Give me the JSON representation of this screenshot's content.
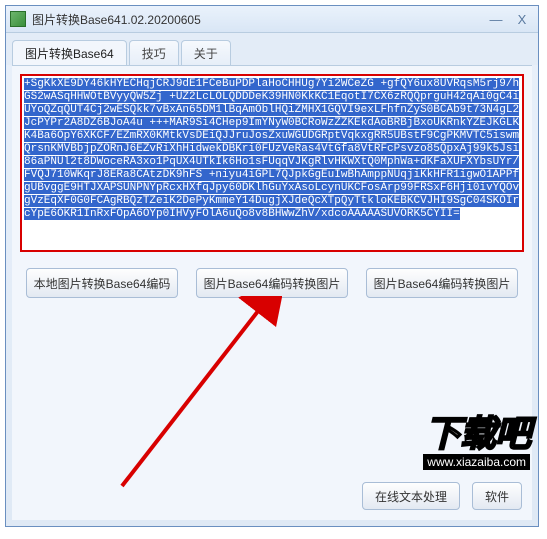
{
  "window": {
    "title": "图片转换Base641.02.20200605",
    "minimize": "—",
    "close": "X"
  },
  "tabs": [
    {
      "label": "图片转换Base64",
      "active": true
    },
    {
      "label": "技巧",
      "active": false
    },
    {
      "label": "关于",
      "active": false
    }
  ],
  "textbox": {
    "value": "+SgKkXE9DY46kHYECHqjCRJ9dE1FCeBuPDPlaHoCHHUg7Yi2WCeZG\n+gfQY6ux8UVRqsM5rj9/hGS2wASqHHWOtBVyyQW5Zj\n+UZ2LcLOLQDDDeK39HN0KkKC1EqotI7CX6zRQQprguH42qAi0gC4iUYoQZqQUT4Cj2wESQkk7vBxAn65DM1lBqAmOblHQiZMHX1GQVI9exLFhfnZyS0BCAb9t73N4gL2JcPYPr2A8DZ6BJoA4u\n+++MAR9Si4CHep9ImYNyW0BCRoWzZZKEkdAoBRBjBxoUKRnkYZEJKGLKK4Ba6OpY6XKCF/EZmRX0KMtkVsDEiQJJruJosZxuWGUDGRptVqkxgRR5UBstF9CgPKMVTC5iswmQrsnKMVBbjpZORnJ6EZvRiXhHidwekDBKri0FUzVeRas4VtGfa8VtRFcPsvzo85QpxAj99k5Jsi86aPNUl2t8DWoceRA3xo1PqUX4UTkIk6Ho1sFUqqVJKgRlvHKWXtQ0MphWa+dKFaXUFXYbsUYr/FVQJ710WKqrJ8ERa8CAtzDK9hFS\n+niyu4iGPL7QJpkGgEuIwBhAmppNUqjiKkHFR1igwO1APPfgUBvggE9HTJXAPSUNPNYpRcxHXfqJpy60DKlhGuYxAsoLcynUKCFosArp99FRSxF6Hji0ivYQOvgVzEqXF0G0FCAgRBQzTZeiK2DePyKmmeY14DugjXJdeQcXTpQyTtkloKEBKCVJHI9SgC04SKOIrcYpE6OKR1InRxFOpA6OYp0IHVyFOlA6uQo8v8BHWwZhV/xdcoAAAAASUVORK5CYII="
  },
  "buttons": {
    "b1": "本地图片转换Base64编码",
    "b2": "图片Base64编码转换图片",
    "b3": "图片Base64编码转换图片"
  },
  "bottom": {
    "online": "在线文本处理",
    "soft": "软件"
  },
  "watermark": {
    "text": "下载吧",
    "url": "www.xiazaiba.com"
  },
  "chart_data": null
}
